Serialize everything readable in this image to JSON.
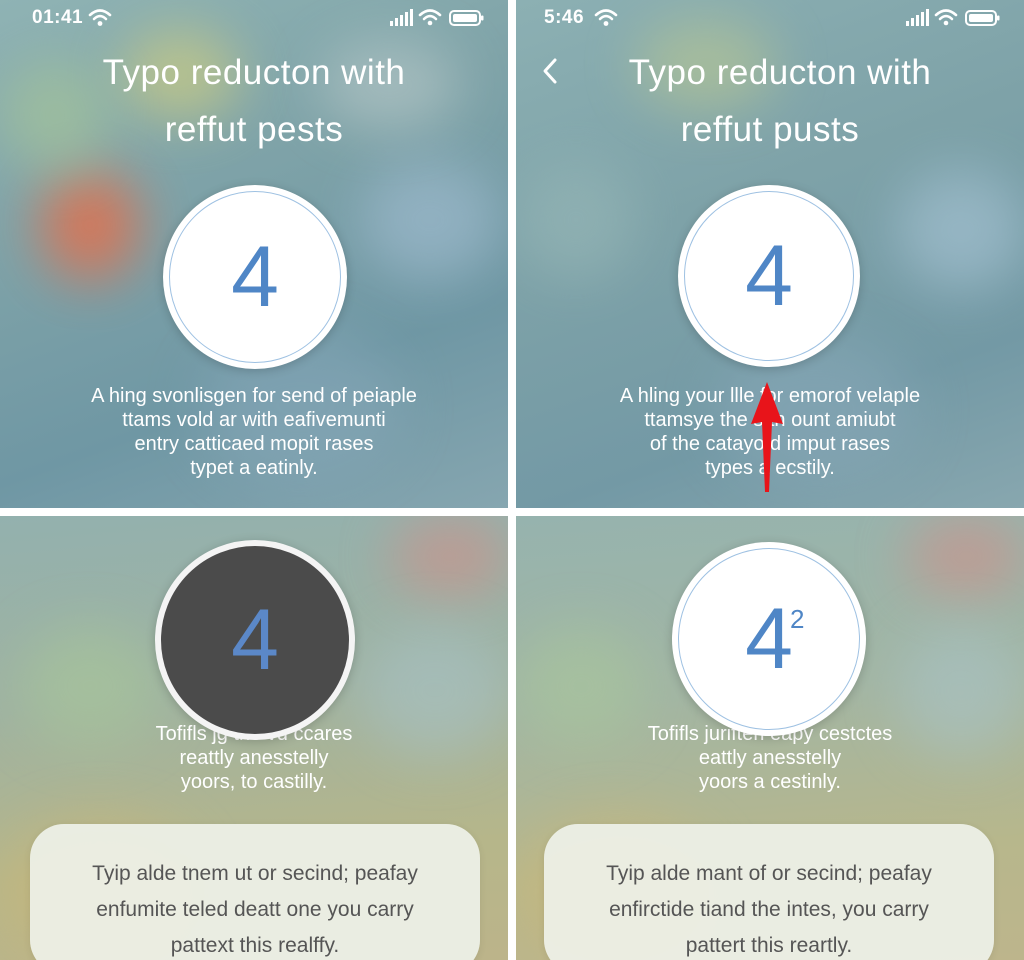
{
  "panels": {
    "top_left": {
      "status": {
        "time": "01:41"
      },
      "title": [
        "Typo  reducton  with",
        "reffut pests"
      ],
      "circle_digit": "4",
      "paragraph": [
        "A hing svonlisgen for send of peiaple",
        "ttams vold ar with eafivemunti",
        "entry catticaed mopit rases",
        "typet a eatinly."
      ]
    },
    "top_right": {
      "status": {
        "time": "5:46"
      },
      "back_icon": "‹",
      "title": [
        "Typo  reducton  with",
        "reffut pusts"
      ],
      "circle_digit": "4",
      "paragraph": [
        "A hling your llle   for emorof velaple",
        "ttamsye the s    th ount amiubt",
        "of the catayo    d imput rases",
        "types a    ecstily."
      ],
      "arrow_color": "#e8141a"
    },
    "bottom_left": {
      "circle_digit": "4",
      "paragraph": [
        "Tofifls jg the                    vd ccares",
        "reattly anesstelly",
        "yoors, to castilly."
      ],
      "card": [
        "Tyip alde tnem ut or secind; peafay",
        "enfumite teled deatt one you carry",
        "pattext this realffy."
      ]
    },
    "bottom_right": {
      "circle_digit": "4",
      "circle_superscript": "2",
      "paragraph": [
        "Tofifls jurifteri     eapy cestctes",
        "eattly anesstelly",
        "yoors a cestinly."
      ],
      "card": [
        "Tyip alde mant of or secind; peafay",
        "enfirctide tiand the intes, you carry",
        "pattert this reartly."
      ]
    }
  },
  "icons": {
    "wifi": "wifi-icon",
    "signal": "signal-bars-icon",
    "battery": "battery-icon",
    "back": "chevron-left-icon",
    "arrow": "red-arrow-up-icon"
  }
}
